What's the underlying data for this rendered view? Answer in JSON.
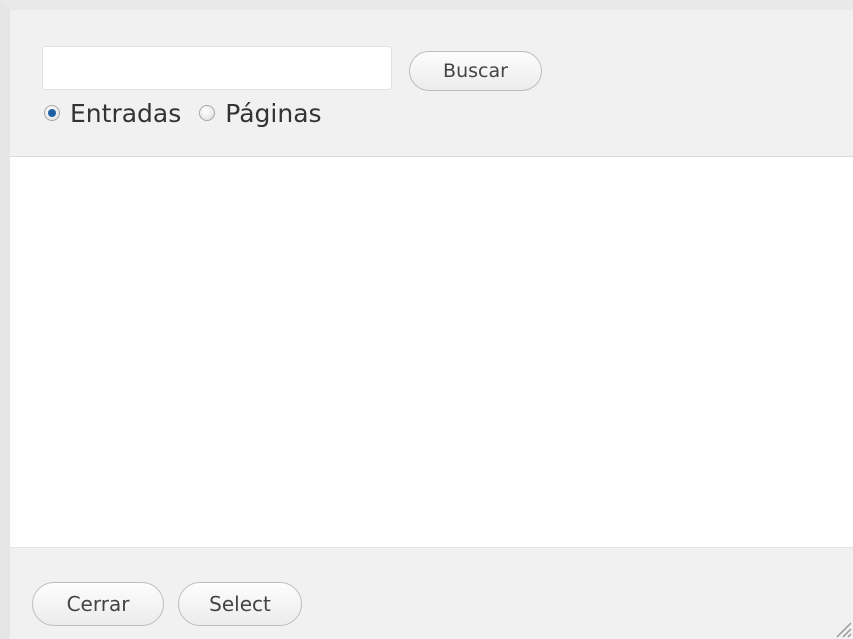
{
  "search": {
    "value": "",
    "placeholder": "",
    "button_label": "Buscar"
  },
  "filters": [
    {
      "label": "Entradas",
      "checked": true
    },
    {
      "label": "Páginas",
      "checked": false
    }
  ],
  "actions": {
    "close_label": "Cerrar",
    "select_label": "Select"
  },
  "colors": {
    "panel_bg": "#f1f1f1",
    "results_bg": "#ffffff",
    "radio_selected": "#1f5fa3"
  },
  "icons": {
    "resize": "resize-grip-icon"
  }
}
